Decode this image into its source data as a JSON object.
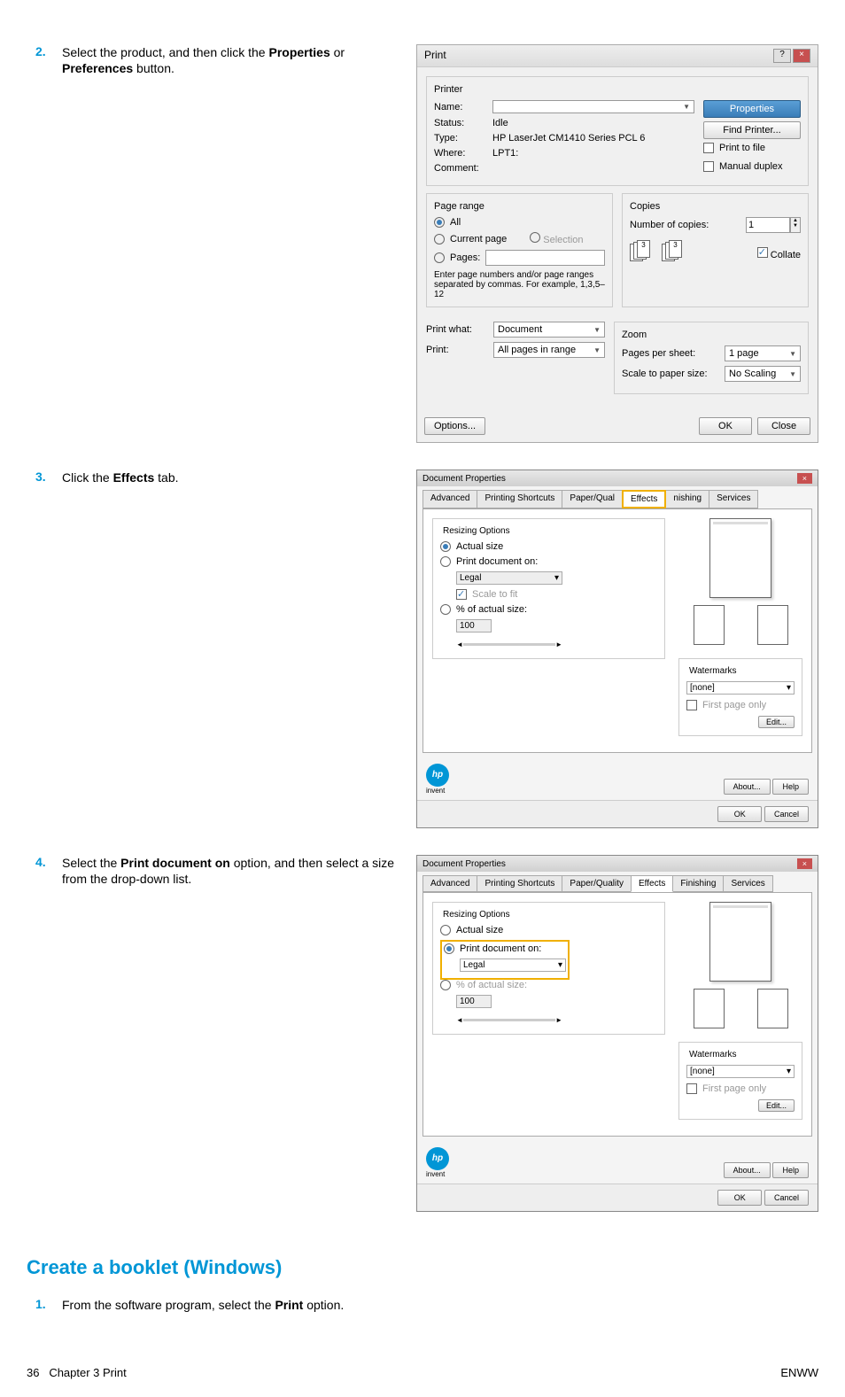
{
  "step2": {
    "num": "2.",
    "text_before": "Select the product, and then click the ",
    "bold1": "Properties",
    "text_mid": " or ",
    "bold2": "Preferences",
    "text_after": " button."
  },
  "step3": {
    "num": "3.",
    "text_before": "Click the ",
    "bold1": "Effects",
    "text_after": " tab."
  },
  "step4": {
    "num": "4.",
    "text_before": "Select the ",
    "bold1": "Print document on",
    "text_mid": " option, and then select a size from the drop-down list."
  },
  "print_dialog": {
    "title": "Print",
    "printer_section": "Printer",
    "name_label": "Name:",
    "name_value": "",
    "properties_btn": "Properties",
    "status_label": "Status:",
    "status_value": "Idle",
    "type_label": "Type:",
    "type_value": "HP LaserJet CM1410 Series PCL 6",
    "where_label": "Where:",
    "where_value": "LPT1:",
    "comment_label": "Comment:",
    "find_printer_btn": "Find Printer...",
    "print_to_file": "Print to file",
    "manual_duplex": "Manual duplex",
    "page_range_section": "Page range",
    "all": "All",
    "current_page": "Current page",
    "selection": "Selection",
    "pages": "Pages:",
    "pages_hint": "Enter page numbers and/or page ranges separated by commas. For example, 1,3,5–12",
    "copies_section": "Copies",
    "num_copies": "Number of copies:",
    "num_copies_val": "1",
    "collate": "Collate",
    "print_what": "Print what:",
    "print_what_val": "Document",
    "print": "Print:",
    "print_val": "All pages in range",
    "zoom_section": "Zoom",
    "pages_per_sheet": "Pages per sheet:",
    "pages_per_sheet_val": "1 page",
    "scale_to_paper": "Scale to paper size:",
    "scale_to_paper_val": "No Scaling",
    "options_btn": "Options...",
    "ok_btn": "OK",
    "close_btn": "Close"
  },
  "docprops": {
    "title": "Document Properties",
    "tabs": [
      "Advanced",
      "Printing Shortcuts",
      "Paper/Qual",
      "Effects",
      "nishing",
      "Services"
    ],
    "tabs2": [
      "Advanced",
      "Printing Shortcuts",
      "Paper/Quality",
      "Effects",
      "Finishing",
      "Services"
    ],
    "resizing_options": "Resizing Options",
    "actual_size": "Actual size",
    "print_doc_on": "Print document on:",
    "legal": "Legal",
    "scale_to_fit": "Scale to fit",
    "percent_actual": "% of actual size:",
    "percent_val": "100",
    "watermarks": "Watermarks",
    "none": "[none]",
    "first_page_only": "First page only",
    "edit_btn": "Edit...",
    "about_btn": "About...",
    "help_btn": "Help",
    "ok_btn": "OK",
    "cancel_btn": "Cancel",
    "invent": "invent"
  },
  "heading": "Create a booklet (Windows)",
  "step1b": {
    "num": "1.",
    "text_before": "From the software program, select the ",
    "bold1": "Print",
    "text_after": " option."
  },
  "footer": {
    "left_num": "36",
    "left_text": "Chapter 3   Print",
    "right": "ENWW"
  }
}
